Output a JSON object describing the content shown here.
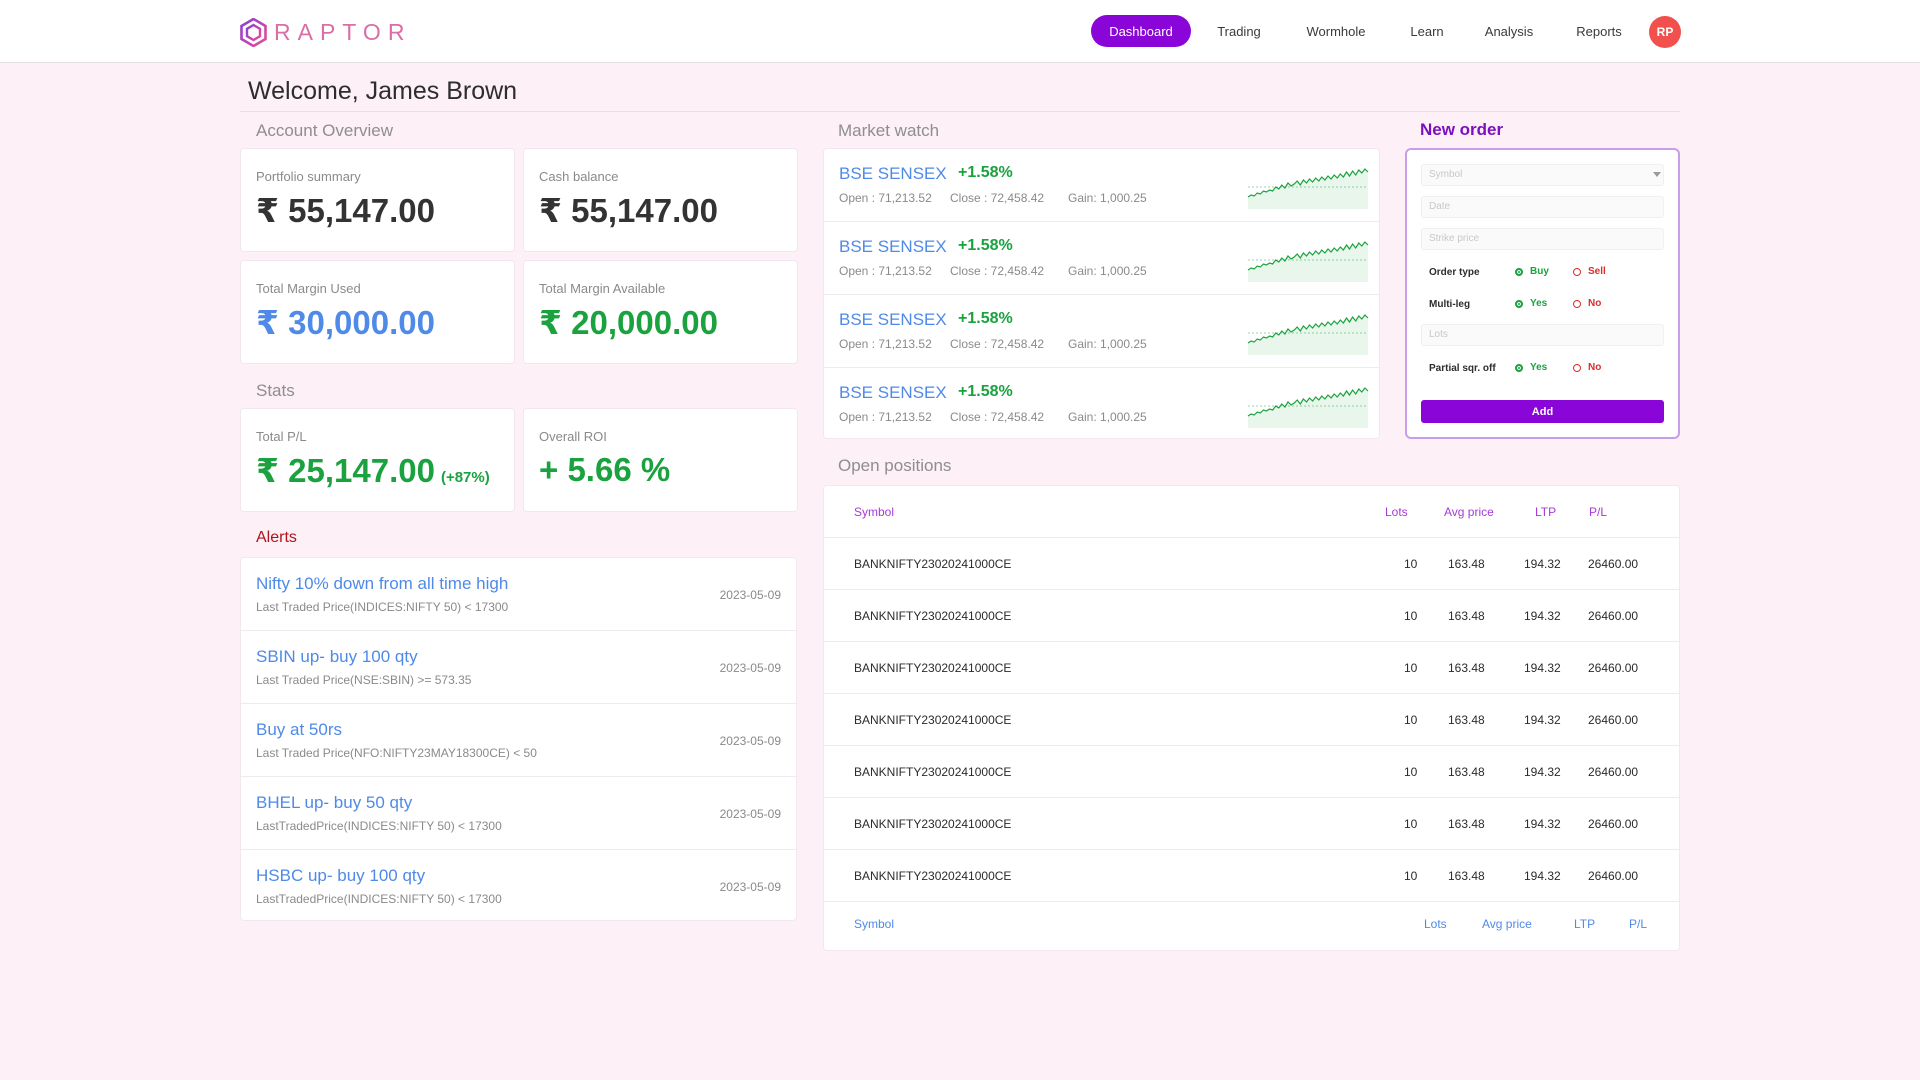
{
  "brand": {
    "name": "RAPTOR"
  },
  "nav": {
    "items": [
      "Dashboard",
      "Trading",
      "Wormhole",
      "Learn",
      "Analysis",
      "Reports"
    ],
    "active": "Dashboard",
    "avatar_initials": "RP"
  },
  "welcome": "Welcome, James Brown",
  "account_overview": {
    "title": "Account Overview",
    "cards": [
      {
        "label": "Portfolio summary",
        "value": "₹ 55,147.00",
        "color": "#333333"
      },
      {
        "label": "Cash balance",
        "value": "₹ 55,147.00",
        "color": "#333333"
      },
      {
        "label": "Total Margin Used",
        "value": "₹ 30,000.00",
        "color": "#4f8ae8"
      },
      {
        "label": "Total Margin Available",
        "value": "₹ 20,000.00",
        "color": "#1aa23f"
      }
    ]
  },
  "stats": {
    "title": "Stats",
    "cards": [
      {
        "label": "Total P/L",
        "value": "₹ 25,147.00",
        "sub": "(+87%)"
      },
      {
        "label": "Overall ROI",
        "value": "+ 5.66 %"
      }
    ]
  },
  "alerts": {
    "title": "Alerts",
    "items": [
      {
        "title": "Nifty 10% down from all time high",
        "condition": "Last Traded Price(INDICES:NIFTY 50) < 17300",
        "date": "2023-05-09"
      },
      {
        "title": "SBIN up- buy 100 qty",
        "condition": "Last Traded Price(NSE:SBIN) >= 573.35",
        "date": "2023-05-09"
      },
      {
        "title": "Buy at 50rs",
        "condition": "Last Traded Price(NFO:NIFTY23MAY18300CE) < 50",
        "date": "2023-05-09"
      },
      {
        "title": "BHEL up- buy 50 qty",
        "condition": "LastTradedPrice(INDICES:NIFTY 50) < 17300",
        "date": "2023-05-09"
      },
      {
        "title": "HSBC up- buy 100 qty",
        "condition": "LastTradedPrice(INDICES:NIFTY 50) < 17300",
        "date": "2023-05-09"
      }
    ]
  },
  "market_watch": {
    "title": "Market watch",
    "items": [
      {
        "name": "BSE SENSEX",
        "change": "+1.58%",
        "open": "Open : 71,213.52",
        "close": "Close : 72,458.42",
        "gain": "Gain: 1,000.25"
      },
      {
        "name": "BSE SENSEX",
        "change": "+1.58%",
        "open": "Open : 71,213.52",
        "close": "Close : 72,458.42",
        "gain": "Gain: 1,000.25"
      },
      {
        "name": "BSE SENSEX",
        "change": "+1.58%",
        "open": "Open : 71,213.52",
        "close": "Close : 72,458.42",
        "gain": "Gain: 1,000.25"
      },
      {
        "name": "BSE SENSEX",
        "change": "+1.58%",
        "open": "Open : 71,213.52",
        "close": "Close : 72,458.42",
        "gain": "Gain: 1,000.25"
      }
    ]
  },
  "new_order": {
    "title": "New order",
    "symbol_placeholder": "Symbol",
    "date_placeholder": "Date",
    "strike_placeholder": "Strike price",
    "lots_placeholder": "Lots",
    "order_type_label": "Order type",
    "order_type_options": [
      "Buy",
      "Sell"
    ],
    "multileg_label": "Multi-leg",
    "multileg_options": [
      "Yes",
      "No"
    ],
    "partial_label": "Partial sqr. off",
    "partial_options": [
      "Yes",
      "No"
    ],
    "add_label": "Add"
  },
  "open_positions": {
    "title": "Open positions",
    "columns": [
      "Symbol",
      "Lots",
      "Avg price",
      "LTP",
      "P/L"
    ],
    "rows": [
      [
        "BANKNIFTY23020241000CE",
        "10",
        "163.48",
        "194.32",
        "26460.00"
      ],
      [
        "BANKNIFTY23020241000CE",
        "10",
        "163.48",
        "194.32",
        "26460.00"
      ],
      [
        "BANKNIFTY23020241000CE",
        "10",
        "163.48",
        "194.32",
        "26460.00"
      ],
      [
        "BANKNIFTY23020241000CE",
        "10",
        "163.48",
        "194.32",
        "26460.00"
      ],
      [
        "BANKNIFTY23020241000CE",
        "10",
        "163.48",
        "194.32",
        "26460.00"
      ],
      [
        "BANKNIFTY23020241000CE",
        "10",
        "163.48",
        "194.32",
        "26460.00"
      ],
      [
        "BANKNIFTY23020241000CE",
        "10",
        "163.48",
        "194.32",
        "26460.00"
      ]
    ]
  },
  "colors": {
    "accent": "#8a05d8",
    "positive": "#1aa23f",
    "negative": "#d92c2c",
    "link": "#4f8ae8",
    "alert_title": "#b0121b"
  }
}
